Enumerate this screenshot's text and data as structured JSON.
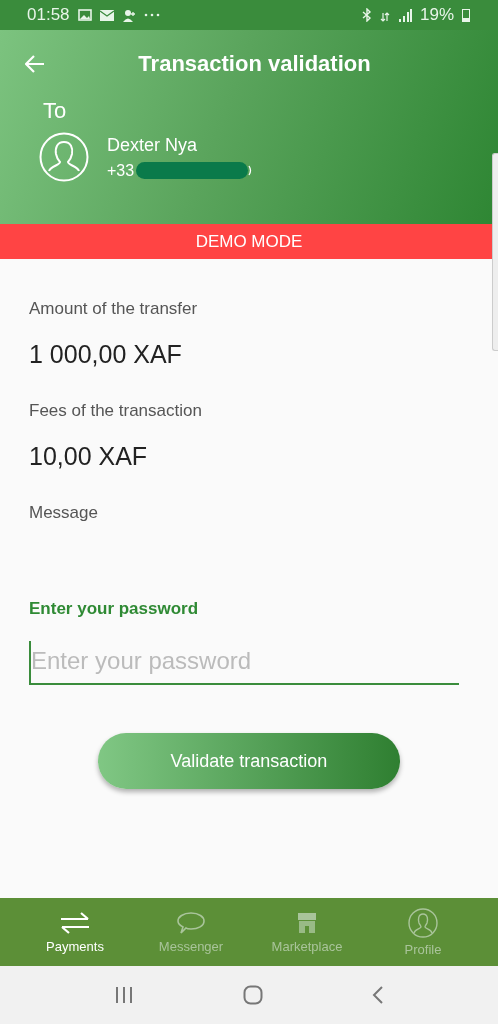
{
  "status_bar": {
    "time": "01:58",
    "battery": "19%"
  },
  "header": {
    "title": "Transaction validation",
    "to_label": "To",
    "recipient": {
      "name": "Dexter Nya",
      "phone": "+33"
    }
  },
  "banner": "DEMO MODE",
  "fields": [
    {
      "label": "Amount of the transfer",
      "value": "1 000,00 XAF"
    },
    {
      "label": "Fees of the transaction",
      "value": "10,00 XAF"
    },
    {
      "label": "Message"
    }
  ],
  "password": {
    "label": "Enter your password",
    "placeholder": "Enter your password"
  },
  "validate_button": "Validate transaction",
  "tabs": [
    {
      "label": "Payments",
      "selected": true
    },
    {
      "label": "Messenger",
      "selected": false
    },
    {
      "label": "Marketplace",
      "selected": false
    },
    {
      "label": "Profile",
      "selected": false
    }
  ]
}
